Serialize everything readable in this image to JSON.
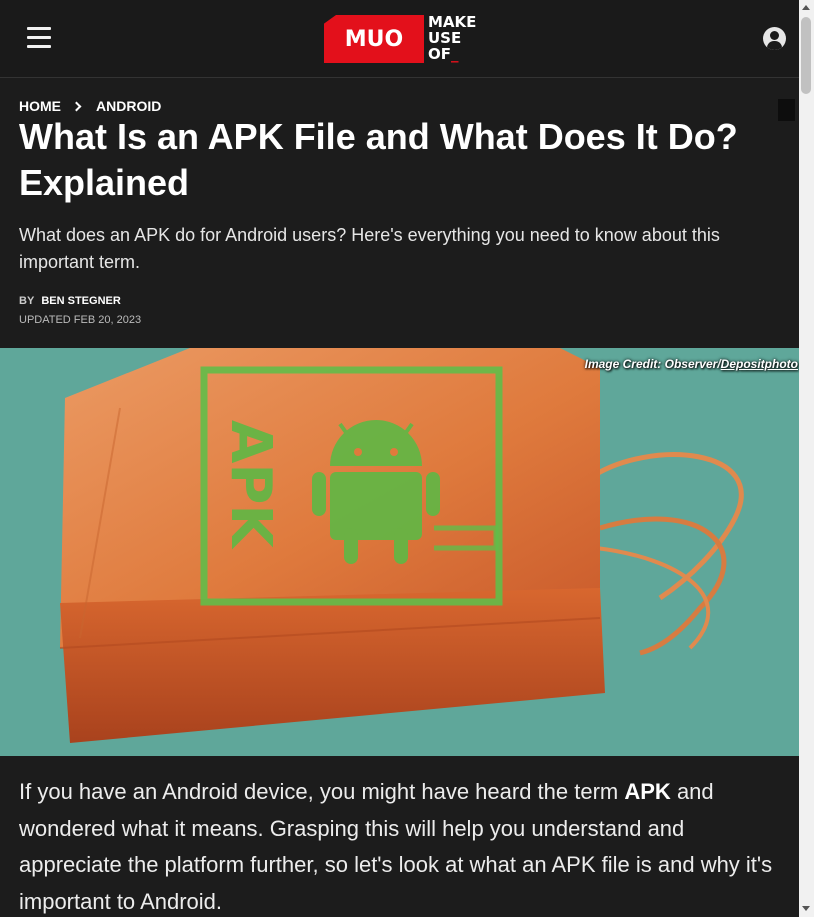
{
  "header": {
    "logo_mark": "MUO",
    "logo_line1": "MAKE",
    "logo_line2": "USE",
    "logo_line3": "OF",
    "logo_line3_accent": "_"
  },
  "breadcrumb": {
    "home": "HOME",
    "category": "ANDROID"
  },
  "article": {
    "title": "What Is an APK File and What Does It Do? Explained",
    "subtitle": "What does an APK do for Android users? Here's everything you need to know about this important term.",
    "by_label": "BY",
    "author": "BEN STEGNER",
    "updated": "UPDATED FEB 20, 2023",
    "image_credit_prefix": "Image Credit: Observer/",
    "image_credit_link": "Depositphoto",
    "image_label": "APK",
    "body_part1": "If you have an Android device, you might have heard the term ",
    "body_bold": "APK",
    "body_part2": " and wondered what it means. Grasping this will help you understand and appreciate the platform further, so let's look at what an APK file is and why it's important to Android."
  },
  "colors": {
    "brand_red": "#e3101b",
    "background": "#1c1c1c",
    "hero_teal": "#5fa79a",
    "bag_orange": "#e07a3c",
    "android_green": "#5fb845"
  }
}
